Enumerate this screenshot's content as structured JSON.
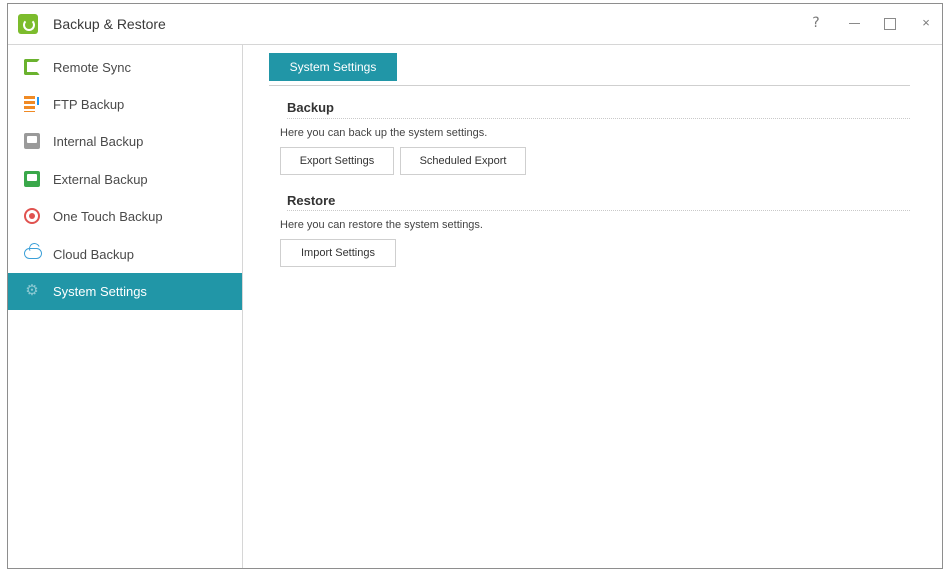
{
  "window": {
    "title": "Backup & Restore",
    "controls": {
      "help": "?",
      "close": "×"
    }
  },
  "sidebar": {
    "items": [
      {
        "label": "Remote Sync",
        "icon": "remote-sync-icon"
      },
      {
        "label": "FTP Backup",
        "icon": "ftp-backup-icon"
      },
      {
        "label": "Internal Backup",
        "icon": "internal-backup-icon"
      },
      {
        "label": "External Backup",
        "icon": "external-backup-icon"
      },
      {
        "label": "One Touch Backup",
        "icon": "one-touch-backup-icon"
      },
      {
        "label": "Cloud Backup",
        "icon": "cloud-backup-icon"
      },
      {
        "label": "System Settings",
        "icon": "gear-icon",
        "active": true
      }
    ]
  },
  "main": {
    "tab_label": "System Settings",
    "backup": {
      "title": "Backup",
      "description": "Here you can back up the system settings.",
      "export_button": "Export Settings",
      "scheduled_button": "Scheduled Export"
    },
    "restore": {
      "title": "Restore",
      "description": "Here you can restore the system settings.",
      "import_button": "Import Settings"
    }
  },
  "colors": {
    "accent": "#2196a7",
    "app_icon": "#7cbc2d"
  }
}
